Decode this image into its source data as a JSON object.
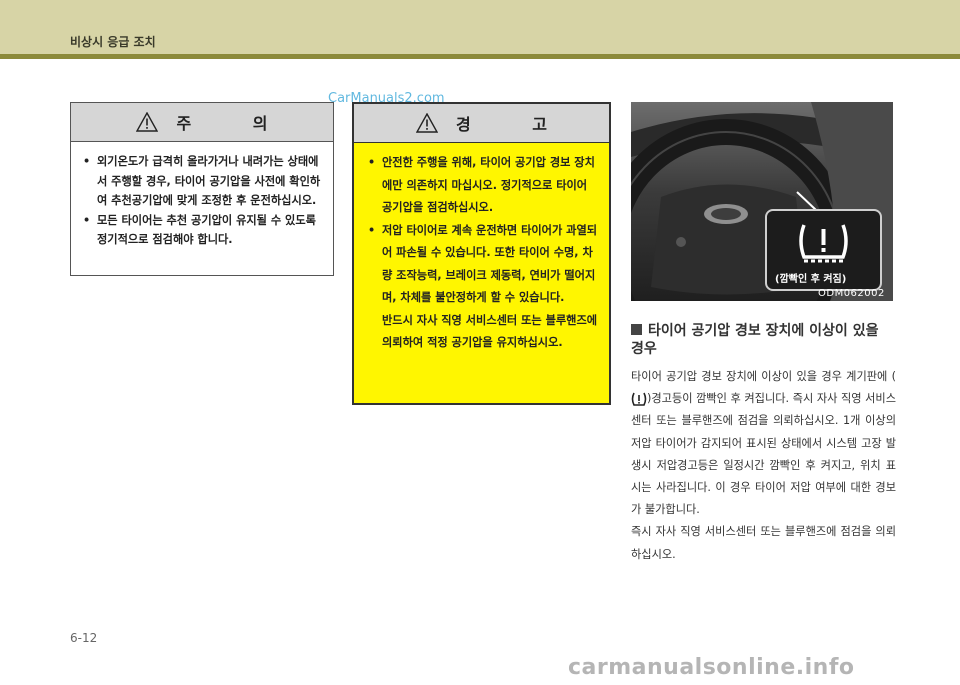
{
  "header": {
    "title": "비상시 응급 조치"
  },
  "watermark_top": "CarManuals2.com",
  "caution": {
    "label": "주 의",
    "items": [
      "외기온도가 급격히 올라가거나 내려가는 상태에서 주행할 경우, 타이어 공기압을 사전에 확인하여 추천공기압에 맞게 조정한 후 운전하십시오.",
      "모든 타이어는 추천 공기압이 유지될 수 있도록 정기적으로 점검해야 합니다."
    ]
  },
  "warning": {
    "label": "경 고",
    "items": [
      "안전한 주행을 위해, 타이어 공기압 경보 장치에만 의존하지 마십시오. 정기적으로 타이어 공기압을 점검하십시오.",
      "저압 타이어로 계속 운전하면 타이어가 과열되어 파손될 수 있습니다. 또한 타이어 수명, 차량 조작능력, 브레이크 제동력, 연비가 떨어지며, 차체를 불안정하게 할 수 있습니다."
    ],
    "extra": "반드시 자사 직영 서비스센터 또는 블루핸즈에 의뢰하여 적정 공기압을 유지하십시오."
  },
  "photo": {
    "inset_caption": "(깜빡인 후 켜짐)",
    "code": "ODM062002"
  },
  "section": {
    "title": "타이어 공기압 경보 장치에 이상이 있을 경우",
    "para1_a": "타이어 공기압 경보 장치에 이상이 있을 경우 계기판에 (",
    "para1_b": ")경고등이 깜빡인 후 켜집니다. 즉시 자사 직영 서비스센터 또는 블루핸즈에 점검을 의뢰하십시오. 1개 이상의 저압 타이어가 감지되어 표시된 상태에서 시스템 고장 발생시 저압경고등은 일정시간 깜빡인 후 켜지고, 위치 표시는 사라집니다. 이 경우 타이어 저압 여부에 대한 경보가 불가합니다.",
    "para2": "즉시 자사 직영 서비스센터 또는 블루핸즈에 점검을 의뢰하십시오."
  },
  "page_number": "6-12",
  "watermark_bottom": "carmanualsonline.info",
  "colors": {
    "header_bg": "#d7d4a6",
    "header_line": "#8c8a3a",
    "warning_bg": "#fff600",
    "box_head": "#d6d6d6"
  },
  "icons": [
    "warning-triangle-icon",
    "tpms-warning-icon"
  ]
}
